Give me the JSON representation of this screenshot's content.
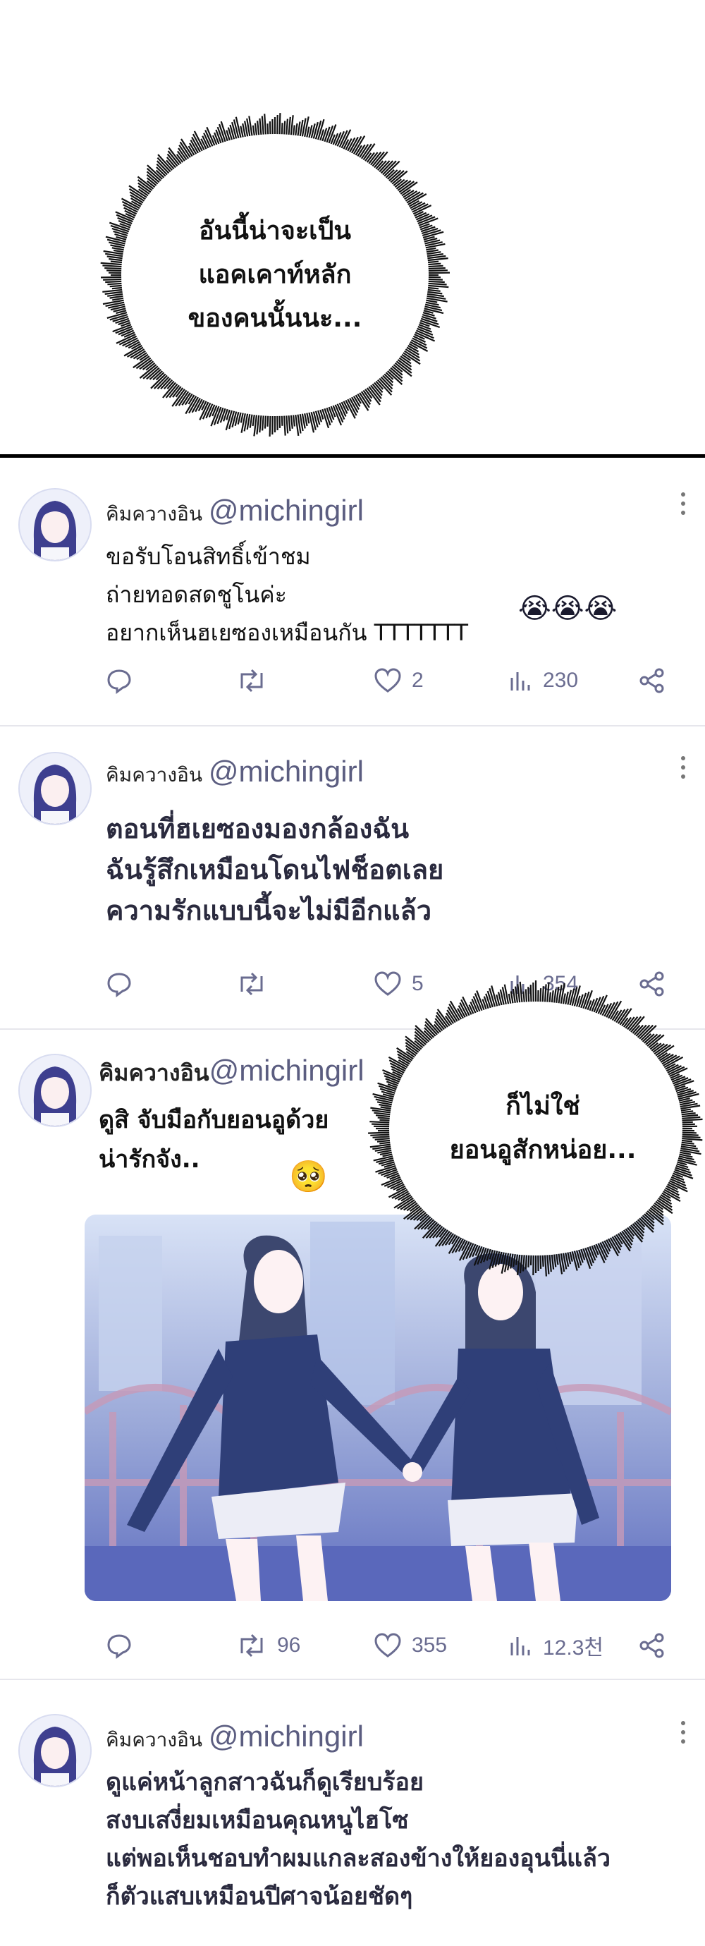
{
  "bubble_top": {
    "lines": [
      "อันนี้น่าจะเป็น",
      "แอคเคาท์หลัก",
      "ของคนนั้นนะ..."
    ]
  },
  "bubble_mid": {
    "lines": [
      "ก็ไม่ใช่",
      "ยอนอูสักหน่อย..."
    ]
  },
  "posts": [
    {
      "name": "คิมควางอิน",
      "handle": "@michingirl",
      "body": "ขอรับโอนสิทธิ์เข้าชม\nถ่ายทอดสดชูโนค่ะ\nอยากเห็นฮเยซองเหมือนกัน TTTTTTT",
      "emoji": "😭😭😭",
      "replies": "",
      "reposts": "",
      "likes": "2",
      "views": "230"
    },
    {
      "name": "คิมควางอิน",
      "handle": "@michingirl",
      "body": "ตอนที่ฮเยซองมองกล้องฉัน\nฉันรู้สึกเหมือนโดนไฟช็อตเลย\nความรักแบบนี้จะไม่มีอีกแล้ว",
      "replies": "",
      "reposts": "",
      "likes": "5",
      "views": "354"
    },
    {
      "name": "คิมควางอิน",
      "handle": "@michingirl",
      "body": "ดูสิ จับมือกับยอนอูด้วย\nน่ารักจัง..",
      "emoji": "🥺",
      "replies": "",
      "reposts": "96",
      "likes": "355",
      "views": "12.3천"
    },
    {
      "name": "คิมควางอิน",
      "handle": "@michingirl",
      "body": "ดูแค่หน้าลูกสาวฉันก็ดูเรียบร้อย\nสงบเสงี่ยมเหมือนคุณหนูไฮโซ\nแต่พอเห็นชอบทำผมแกละสองข้างให้ยองอุนนี่แล้ว\nก็ตัวแสบเหมือนปีศาจน้อยชัดๆ"
    }
  ],
  "icons": {
    "reply": "reply-icon",
    "repost": "repost-icon",
    "like": "heart-icon",
    "views": "views-icon",
    "share": "share-icon",
    "more": "more-icon"
  },
  "colors": {
    "accent": "#6a6c90",
    "divider": "#e6e6ec",
    "photo_tint": "#4b5ea8"
  }
}
